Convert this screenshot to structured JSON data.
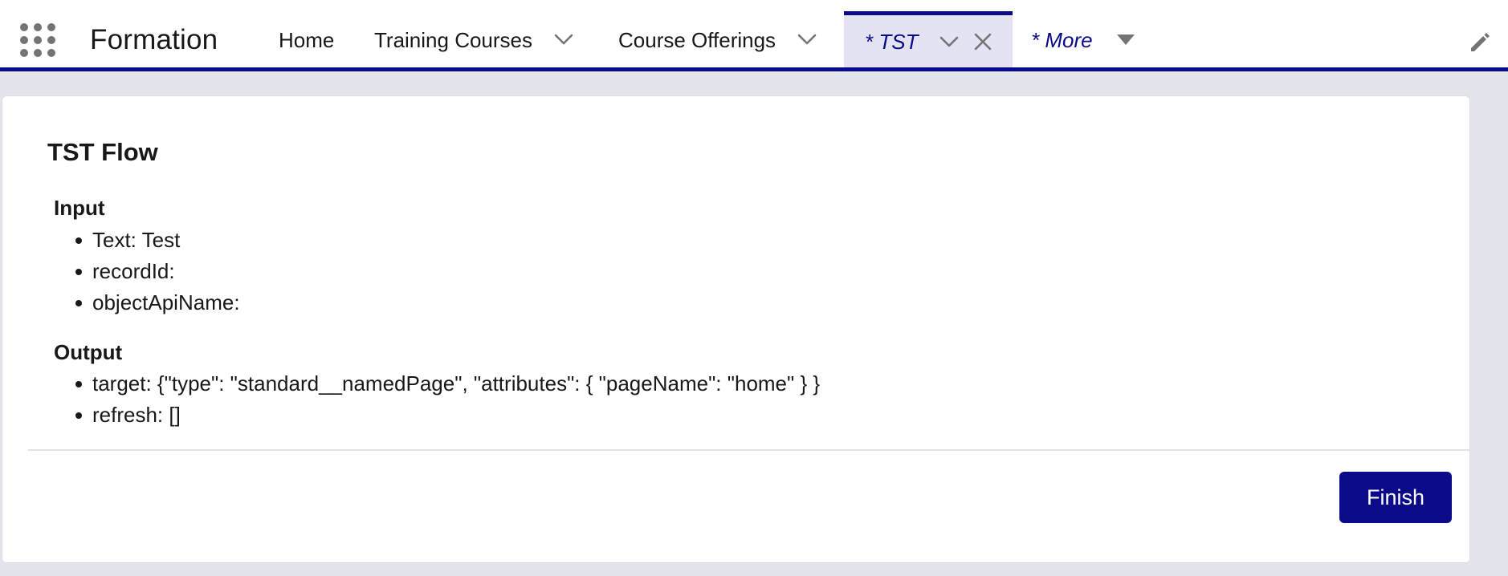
{
  "app": {
    "name": "Formation",
    "launcher_icon": "app-launcher-grid-icon"
  },
  "nav": {
    "items": [
      {
        "label": "Home"
      },
      {
        "label": "Training Courses",
        "icon": "chevron-down-icon"
      },
      {
        "label": "Course Offerings",
        "icon": "chevron-down-icon"
      },
      {
        "label": "* TST",
        "active": true,
        "icon": "chevron-down-icon",
        "close_icon": "close-icon"
      },
      {
        "label": "* More",
        "icon": "caret-down-icon"
      }
    ],
    "edit_icon": "pencil-icon"
  },
  "flow": {
    "title": "TST Flow",
    "input_heading": "Input",
    "input_items": [
      "Text: Test",
      "recordId:",
      "objectApiName:"
    ],
    "output_heading": "Output",
    "output_items": [
      "target: {\"type\": \"standard__namedPage\", \"attributes\": { \"pageName\": \"home\" } }",
      "refresh: []"
    ],
    "finish_label": "Finish"
  },
  "colors": {
    "brand": "#0b0b8a",
    "active_tab_bg": "#e3e3f3",
    "page_bg": "#e4e4ec",
    "icon_gray": "#747474"
  }
}
